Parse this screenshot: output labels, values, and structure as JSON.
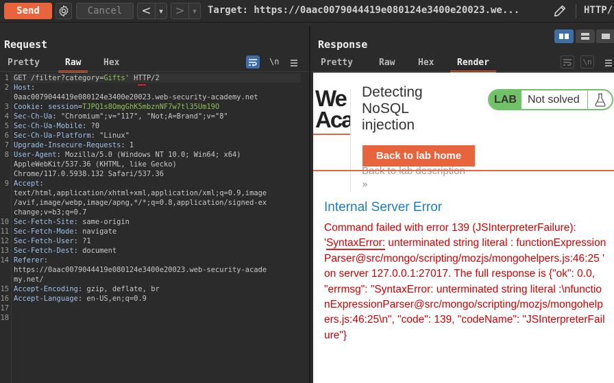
{
  "toolbar": {
    "send_label": "Send",
    "cancel_label": "Cancel",
    "back_arrow": "<",
    "forward_arrow": ">",
    "dropdown_arrow": "▾",
    "target_text": "Target: https://0aac0079044419e080124e3400e20023.we...",
    "protocol_label": "HTTP/"
  },
  "request": {
    "title": "Request",
    "tabs": [
      "Pretty",
      "Raw",
      "Hex"
    ],
    "active_tab": "Raw",
    "newline_toggle": "\\n",
    "lines": [
      {
        "n": "1",
        "parts": [
          {
            "t": "GET /filter?category=",
            "c": "v"
          },
          {
            "t": "Gifts'",
            "c": "g"
          },
          {
            "t": " HTTP/2",
            "c": "v"
          }
        ]
      },
      {
        "n": "2",
        "parts": [
          {
            "t": "Host",
            "c": "k"
          },
          {
            "t": ":",
            "c": "v"
          }
        ]
      },
      {
        "n": "",
        "parts": [
          {
            "t": "0aac0079044419e080124e3400e20023.web-security-academy.net",
            "c": "v"
          }
        ]
      },
      {
        "n": "3",
        "parts": [
          {
            "t": "Cookie",
            "c": "k"
          },
          {
            "t": ": ",
            "c": "v"
          },
          {
            "t": "session",
            "c": "k"
          },
          {
            "t": "=",
            "c": "v"
          },
          {
            "t": "TJPQ1s8OmgGhK5mbznNF7w7tl35Um19O",
            "c": "g"
          }
        ]
      },
      {
        "n": "4",
        "parts": [
          {
            "t": "Sec-Ch-Ua",
            "c": "k"
          },
          {
            "t": ": \"Chromium\";v=\"117\", \"Not;A=Brand\";v=\"8\"",
            "c": "v"
          }
        ]
      },
      {
        "n": "5",
        "parts": [
          {
            "t": "Sec-Ch-Ua-Mobile",
            "c": "k"
          },
          {
            "t": ": ?0",
            "c": "v"
          }
        ]
      },
      {
        "n": "6",
        "parts": [
          {
            "t": "Sec-Ch-Ua-Platform",
            "c": "k"
          },
          {
            "t": ": \"Linux\"",
            "c": "v"
          }
        ]
      },
      {
        "n": "7",
        "parts": [
          {
            "t": "Upgrade-Insecure-Requests",
            "c": "k"
          },
          {
            "t": ": 1",
            "c": "v"
          }
        ]
      },
      {
        "n": "8",
        "parts": [
          {
            "t": "User-Agent",
            "c": "k"
          },
          {
            "t": ": Mozilla/5.0 (Windows NT 10.0; Win64; x64)",
            "c": "v"
          }
        ]
      },
      {
        "n": "",
        "parts": [
          {
            "t": "AppleWebKit/537.36 (KHTML, like Gecko)",
            "c": "v"
          }
        ]
      },
      {
        "n": "",
        "parts": [
          {
            "t": "Chrome/117.0.5938.132 Safari/537.36",
            "c": "v"
          }
        ]
      },
      {
        "n": "9",
        "parts": [
          {
            "t": "Accept",
            "c": "k"
          },
          {
            "t": ":",
            "c": "v"
          }
        ]
      },
      {
        "n": "",
        "parts": [
          {
            "t": "text/html,application/xhtml+xml,application/xml;q=0.9,image",
            "c": "v"
          }
        ]
      },
      {
        "n": "",
        "parts": [
          {
            "t": "/avif,image/webp,image/apng,*/*;q=0.8,application/signed-ex",
            "c": "v"
          }
        ]
      },
      {
        "n": "",
        "parts": [
          {
            "t": "change;v=b3;q=0.7",
            "c": "v"
          }
        ]
      },
      {
        "n": "10",
        "parts": [
          {
            "t": "Sec-Fetch-Site",
            "c": "k"
          },
          {
            "t": ": same-origin",
            "c": "v"
          }
        ]
      },
      {
        "n": "11",
        "parts": [
          {
            "t": "Sec-Fetch-Mode",
            "c": "k"
          },
          {
            "t": ": navigate",
            "c": "v"
          }
        ]
      },
      {
        "n": "12",
        "parts": [
          {
            "t": "Sec-Fetch-User",
            "c": "k"
          },
          {
            "t": ": ?1",
            "c": "v"
          }
        ]
      },
      {
        "n": "13",
        "parts": [
          {
            "t": "Sec-Fetch-Dest",
            "c": "k"
          },
          {
            "t": ": document",
            "c": "v"
          }
        ]
      },
      {
        "n": "14",
        "parts": [
          {
            "t": "Referer",
            "c": "k"
          },
          {
            "t": ":",
            "c": "v"
          }
        ]
      },
      {
        "n": "",
        "parts": [
          {
            "t": "https://0aac0079044419e080124e3400e20023.web-security-acade",
            "c": "v"
          }
        ]
      },
      {
        "n": "",
        "parts": [
          {
            "t": "my.net/",
            "c": "v"
          }
        ]
      },
      {
        "n": "15",
        "parts": [
          {
            "t": "Accept-Encoding",
            "c": "k"
          },
          {
            "t": ": gzip, deflate, br",
            "c": "v"
          }
        ]
      },
      {
        "n": "16",
        "parts": [
          {
            "t": "Accept-Language",
            "c": "k"
          },
          {
            "t": ": en-US,en;q=0.9",
            "c": "v"
          }
        ]
      },
      {
        "n": "17",
        "parts": []
      },
      {
        "n": "18",
        "parts": []
      }
    ]
  },
  "response": {
    "title": "Response",
    "tabs": [
      "Pretty",
      "Raw",
      "Hex",
      "Render"
    ],
    "active_tab": "Render",
    "newline_toggle": "\\n",
    "render": {
      "logo_text": "We\nAca",
      "lab_title": "Detecting NoSQL injection",
      "badge_lab": "LAB",
      "badge_status": "Not solved",
      "back_button": "Back to lab home",
      "back_description": "Back to lab description",
      "chevrons": "»",
      "error_title": "Internal Server Error",
      "error_prefix": " Command failed with error 139 (JSInterpreterFailure): '",
      "error_highlight": "SyntaxError:",
      "error_suffix": " unterminated string literal : functionExpressionParser@src/mongo/scripting/mozjs/mongohelpers.js:46:25 ' on server 127.0.0.1:27017. The full response is {\"ok\": 0.0, \"errmsg\": \"SyntaxError: unterminated string literal :\\nfunctionExpressionParser@src/mongo/scripting/mozjs/mongohelpers.js:46:25\\n\", \"code\": 139, \"codeName\": \"JSInterpreterFailure\"}"
    }
  },
  "colors": {
    "accent": "#e8643c",
    "lab_green": "#70c168",
    "error_red": "#d20000",
    "link_blue": "#1a7ec1"
  }
}
